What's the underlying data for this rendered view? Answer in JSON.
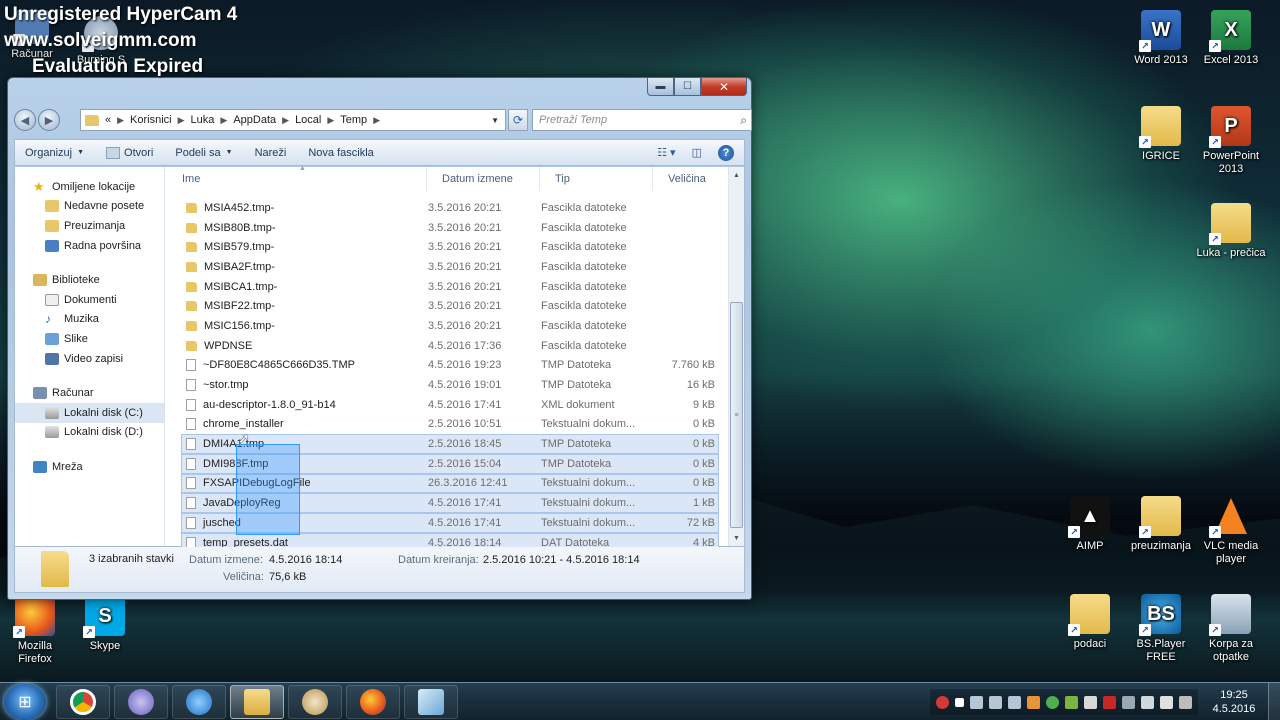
{
  "watermark": {
    "line1": "Unregistered HyperCam 4",
    "line2": "www.solveigmm.com",
    "line3": "Evaluation Expired"
  },
  "desktop_icons_left_top": [
    {
      "label": "Računar",
      "icon": "computer-icon"
    },
    {
      "label": "Burning S",
      "icon": "burning-studio-icon"
    }
  ],
  "desktop_icons": {
    "word": "Word 2013",
    "excel": "Excel 2013",
    "igrice": "IGRICE",
    "powerpoint": "PowerPoint 2013",
    "luka": "Luka - prečica",
    "aimp": "AIMP",
    "preuzimanja": "preuzimanja",
    "vlc": "VLC media player",
    "firefox": "Mozilla Firefox",
    "skype": "Skype",
    "podaci": "podaci",
    "bsplayer": "BS.Player FREE",
    "recycle": "Korpa za otpatke"
  },
  "window": {
    "breadcrumb": [
      "Korisnici",
      "Luka",
      "AppData",
      "Local",
      "Temp"
    ],
    "breadcrumb_prefix": "«",
    "search_placeholder": "Pretraži Temp",
    "toolbar": {
      "organize": "Organizuj",
      "open": "Otvori",
      "share": "Podeli sa",
      "burn": "Nareži",
      "new_folder": "Nova fascikla"
    },
    "nav": {
      "favorites": "Omiljene lokacije",
      "recent": "Nedavne posete",
      "downloads": "Preuzimanja",
      "desktop": "Radna površina",
      "libraries": "Biblioteke",
      "documents": "Dokumenti",
      "music": "Muzika",
      "pictures": "Slike",
      "videos": "Video zapisi",
      "computer": "Računar",
      "disk_c": "Lokalni disk (C:)",
      "disk_d": "Lokalni disk (D:)",
      "network": "Mreža"
    },
    "columns": {
      "name": "Ime",
      "date": "Datum izmene",
      "type": "Tip",
      "size": "Veličina"
    },
    "files": [
      {
        "name": "MSIA452.tmp-",
        "date": "3.5.2016 20:21",
        "type": "Fascikla datoteke",
        "size": "",
        "kind": "folder",
        "selected": false
      },
      {
        "name": "MSIB80B.tmp-",
        "date": "3.5.2016 20:21",
        "type": "Fascikla datoteke",
        "size": "",
        "kind": "folder",
        "selected": false
      },
      {
        "name": "MSIB579.tmp-",
        "date": "3.5.2016 20:21",
        "type": "Fascikla datoteke",
        "size": "",
        "kind": "folder",
        "selected": false
      },
      {
        "name": "MSIBA2F.tmp-",
        "date": "3.5.2016 20:21",
        "type": "Fascikla datoteke",
        "size": "",
        "kind": "folder",
        "selected": false
      },
      {
        "name": "MSIBCA1.tmp-",
        "date": "3.5.2016 20:21",
        "type": "Fascikla datoteke",
        "size": "",
        "kind": "folder",
        "selected": false
      },
      {
        "name": "MSIBF22.tmp-",
        "date": "3.5.2016 20:21",
        "type": "Fascikla datoteke",
        "size": "",
        "kind": "folder",
        "selected": false
      },
      {
        "name": "MSIC156.tmp-",
        "date": "3.5.2016 20:21",
        "type": "Fascikla datoteke",
        "size": "",
        "kind": "folder",
        "selected": false
      },
      {
        "name": "WPDNSE",
        "date": "4.5.2016 17:36",
        "type": "Fascikla datoteke",
        "size": "",
        "kind": "folder",
        "selected": false
      },
      {
        "name": "~DF80E8C4865C666D35.TMP",
        "date": "4.5.2016 19:23",
        "type": "TMP Datoteka",
        "size": "7.760 kB",
        "kind": "file",
        "selected": false
      },
      {
        "name": "~stor.tmp",
        "date": "4.5.2016 19:01",
        "type": "TMP Datoteka",
        "size": "16 kB",
        "kind": "file",
        "selected": false
      },
      {
        "name": "au-descriptor-1.8.0_91-b14",
        "date": "4.5.2016 17:41",
        "type": "XML dokument",
        "size": "9 kB",
        "kind": "file",
        "selected": false
      },
      {
        "name": "chrome_installer",
        "date": "2.5.2016 10:51",
        "type": "Tekstualni dokum...",
        "size": "0 kB",
        "kind": "file",
        "selected": false
      },
      {
        "name": "DMI4A1.tmp",
        "date": "2.5.2016 18:45",
        "type": "TMP Datoteka",
        "size": "0 kB",
        "kind": "file",
        "selected": true
      },
      {
        "name": "DMI988F.tmp",
        "date": "2.5.2016 15:04",
        "type": "TMP Datoteka",
        "size": "0 kB",
        "kind": "file",
        "selected": true
      },
      {
        "name": "FXSAPIDebugLogFile",
        "date": "26.3.2016 12:41",
        "type": "Tekstualni dokum...",
        "size": "0 kB",
        "kind": "file",
        "selected": true
      },
      {
        "name": "JavaDeployReg",
        "date": "4.5.2016 17:41",
        "type": "Tekstualni dokum...",
        "size": "1 kB",
        "kind": "file",
        "selected": true
      },
      {
        "name": "jusched",
        "date": "4.5.2016 17:41",
        "type": "Tekstualni dokum...",
        "size": "72 kB",
        "kind": "file",
        "selected": true
      },
      {
        "name": "temp_presets.dat",
        "date": "4.5.2016 18:14",
        "type": "DAT Datoteka",
        "size": "4 kB",
        "kind": "file",
        "selected": true
      }
    ],
    "details": {
      "count": "3 izabranih stavki",
      "modified_label": "Datum izmene:",
      "modified_value": "4.5.2016 18:14",
      "created_label": "Datum kreiranja:",
      "created_value": "2.5.2016 10:21 - 4.5.2016 18:14",
      "size_label": "Veličina:",
      "size_value": "75,6 kB"
    }
  },
  "taskbar": {
    "apps": [
      "chrome-icon",
      "aimp-icon",
      "thunder-icon",
      "explorer-icon",
      "paint-icon",
      "firefox-icon",
      "window-icon"
    ],
    "time": "19:25",
    "date": "4.5.2016"
  }
}
